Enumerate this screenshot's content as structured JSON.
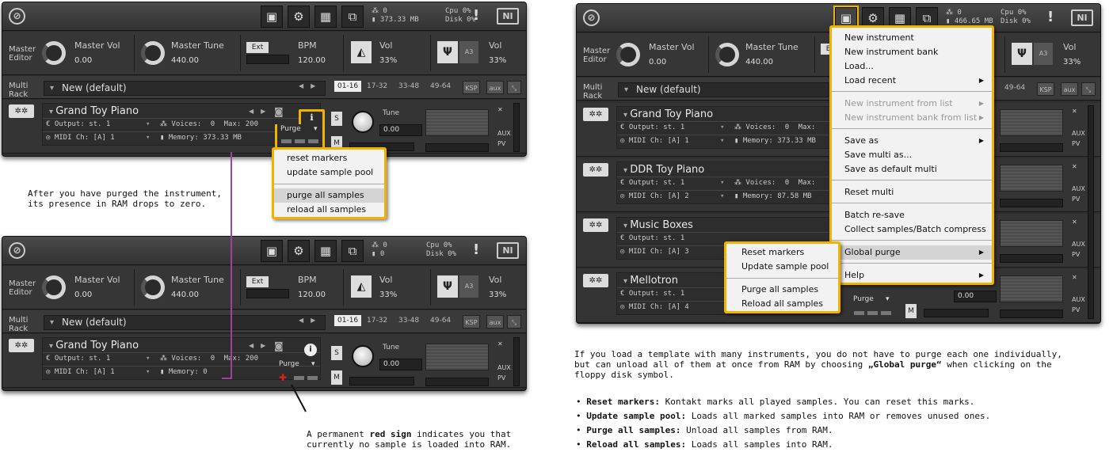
{
  "toolbar": {
    "logo": "⊘",
    "ni": "NI",
    "warn": "!"
  },
  "panel1": {
    "voices_icon": "⁂",
    "voices": "0",
    "ram": "373.33 MB",
    "cpu_label": "Cpu",
    "cpu": "0%",
    "disk_label": "Disk",
    "disk": "0%"
  },
  "panel2": {
    "voices": "0",
    "ram": "0",
    "cpu_label": "Cpu",
    "cpu": "0%",
    "disk_label": "Disk",
    "disk": "0%"
  },
  "panel3": {
    "voices": "0",
    "ram": "466.65 MB",
    "cpu_label": "Cpu",
    "cpu": "0%",
    "disk_label": "Disk",
    "disk": "0%"
  },
  "master": {
    "editor_l1": "Master",
    "editor_l2": "Editor",
    "vol_label": "Master Vol",
    "vol_value": "0.00",
    "tune_label": "Master Tune",
    "tune_value": "440.00",
    "ext": "Ext",
    "bpm_label": "BPM",
    "bpm_value": "120.00",
    "vol2_label": "Vol",
    "vol2_value": "33%",
    "vol3_label": "Vol",
    "vol3_value": "33%",
    "a3": "A3"
  },
  "rack": {
    "label_l1": "Multi",
    "label_l2": "Rack",
    "multi_name": "New (default)",
    "pages": [
      "01-16",
      "17-32",
      "33-48",
      "49-64"
    ],
    "ksp": "KSP",
    "aux": "aux"
  },
  "instrument_labels": {
    "output": "Output:",
    "output_val": "st. 1",
    "voices": "Voices:",
    "max": "Max:",
    "max_val": "200",
    "midi": "MIDI Ch:",
    "memory": "Memory:",
    "tune": "Tune",
    "tune_val": "0.00",
    "purge": "Purge",
    "s": "S",
    "m": "M",
    "aux": "AUX",
    "pv": "PV"
  },
  "instruments_left_top": [
    {
      "name": "Grand Toy Piano",
      "voices": "0",
      "midi": "[A] 1",
      "memory": "373.33 MB"
    }
  ],
  "instruments_left_bottom": [
    {
      "name": "Grand Toy Piano",
      "voices": "0",
      "midi": "[A] 1",
      "memory": "0"
    }
  ],
  "instruments_right": [
    {
      "name": "Grand Toy Piano",
      "voices": "0",
      "midi": "[A] 1",
      "memory": "373.33 MB"
    },
    {
      "name": "DDR Toy Piano",
      "voices": "0",
      "midi": "[A] 2",
      "memory": "87.58 MB"
    },
    {
      "name": "Music Boxes",
      "midi": "[A] 3"
    },
    {
      "name": "Mellotron",
      "midi": "[A] 4"
    }
  ],
  "purge_menu": [
    "reset markers",
    "update sample pool",
    "purge all samples",
    "reload all samples"
  ],
  "file_menu": {
    "items": [
      "New instrument",
      "New instrument bank",
      "Load...",
      "Load recent",
      "New instrument from list",
      "New instrument bank from list",
      "Save as",
      "Save multi as...",
      "Save as default multi",
      "Reset multi",
      "Batch re-save",
      "Collect samples/Batch compress",
      "Global purge",
      "Help"
    ]
  },
  "global_purge_submenu": [
    "Reset markers",
    "Update sample pool",
    "Purge all samples",
    "Reload all samples"
  ],
  "captions": {
    "left_top_l1": "After you have purged the instrument,",
    "left_top_l2": "its presence in RAM drops to zero.",
    "left_bottom_l1a": "A permanent ",
    "left_bottom_l1b": "red sign",
    "left_bottom_l1c": " indicates you that",
    "left_bottom_l2": "currently no sample is loaded into RAM.",
    "right_l1": "If you load a template with many instruments, you do not have to purge each one individually,",
    "right_l2a": "but can unload all of them at once from RAM by choosing ",
    "right_l2b": "„Global purge“",
    "right_l2c": " when clicking on the",
    "right_l3": "floppy disk symbol."
  },
  "bullets": [
    {
      "term": "Reset markers:",
      "text": " Kontakt marks all played samples. You can reset this marks."
    },
    {
      "term": "Update sample pool:",
      "text": " Loads all marked samples into RAM or removes unused ones."
    },
    {
      "term": "Purge all samples:",
      "text": " Unload all samples from RAM."
    },
    {
      "term": "Reload all samples:",
      "text": " Loads all samples into RAM."
    }
  ],
  "colors": {
    "highlight": "#f0b400",
    "connector": "#a040a0",
    "red_sign": "#e02020"
  }
}
